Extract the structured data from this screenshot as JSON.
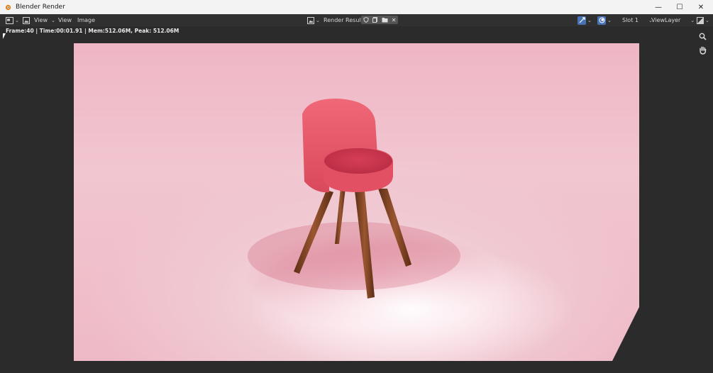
{
  "window": {
    "title": "Blender Render",
    "minimize": "—",
    "maximize": "☐",
    "close": "✕"
  },
  "header": {
    "view_menu_1": "View",
    "view_menu_2": "View",
    "image_menu": "Image",
    "image_name": "Render Result",
    "slot": "Slot 1",
    "view_layer": "ViewLayer"
  },
  "stats": "Frame:40 | Time:00:01.91 | Mem:512.06M, Peak: 512.06M",
  "icons": [
    "blender-logo-icon",
    "editor-type-icon",
    "mode-icon",
    "image-browse-icon",
    "fake-user-icon",
    "new-image-icon",
    "open-image-icon",
    "unlink-icon",
    "gizmo-icon",
    "overlay-icon",
    "display-channels-icon",
    "zoom-icon",
    "hand-icon"
  ],
  "colors": {
    "seat": "#e85a6b",
    "legs": "#8a4a2a",
    "backdrop": "#f0c3cf"
  }
}
